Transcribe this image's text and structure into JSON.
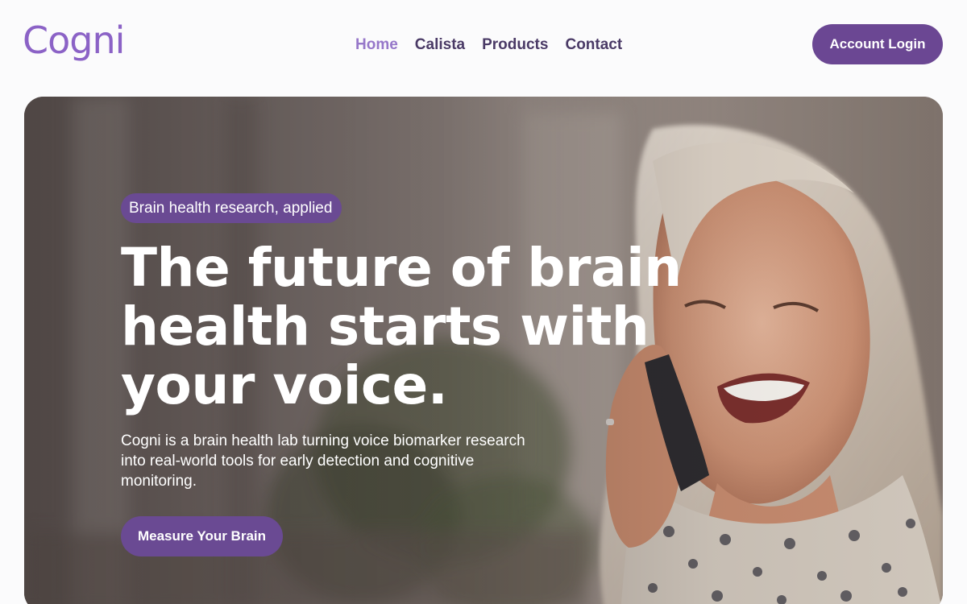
{
  "brand": {
    "logo_text": "Cogni",
    "logo_color": "#8b62c6",
    "accent": "#6b4793"
  },
  "nav": {
    "items": [
      {
        "label": "Home",
        "active": true
      },
      {
        "label": "Calista",
        "active": false
      },
      {
        "label": "Products",
        "active": false
      },
      {
        "label": "Contact",
        "active": false
      }
    ]
  },
  "header": {
    "login_label": "Account Login"
  },
  "hero": {
    "badge": "Brain health research, applied",
    "headline": "The future of brain health starts with your voice.",
    "subtext": "Cogni is a brain health lab turning voice biomarker research into real-world tools for early detection and cognitive monitoring.",
    "cta_label": "Measure Your Brain",
    "image": "photo-woman-smiling-on-phone"
  }
}
